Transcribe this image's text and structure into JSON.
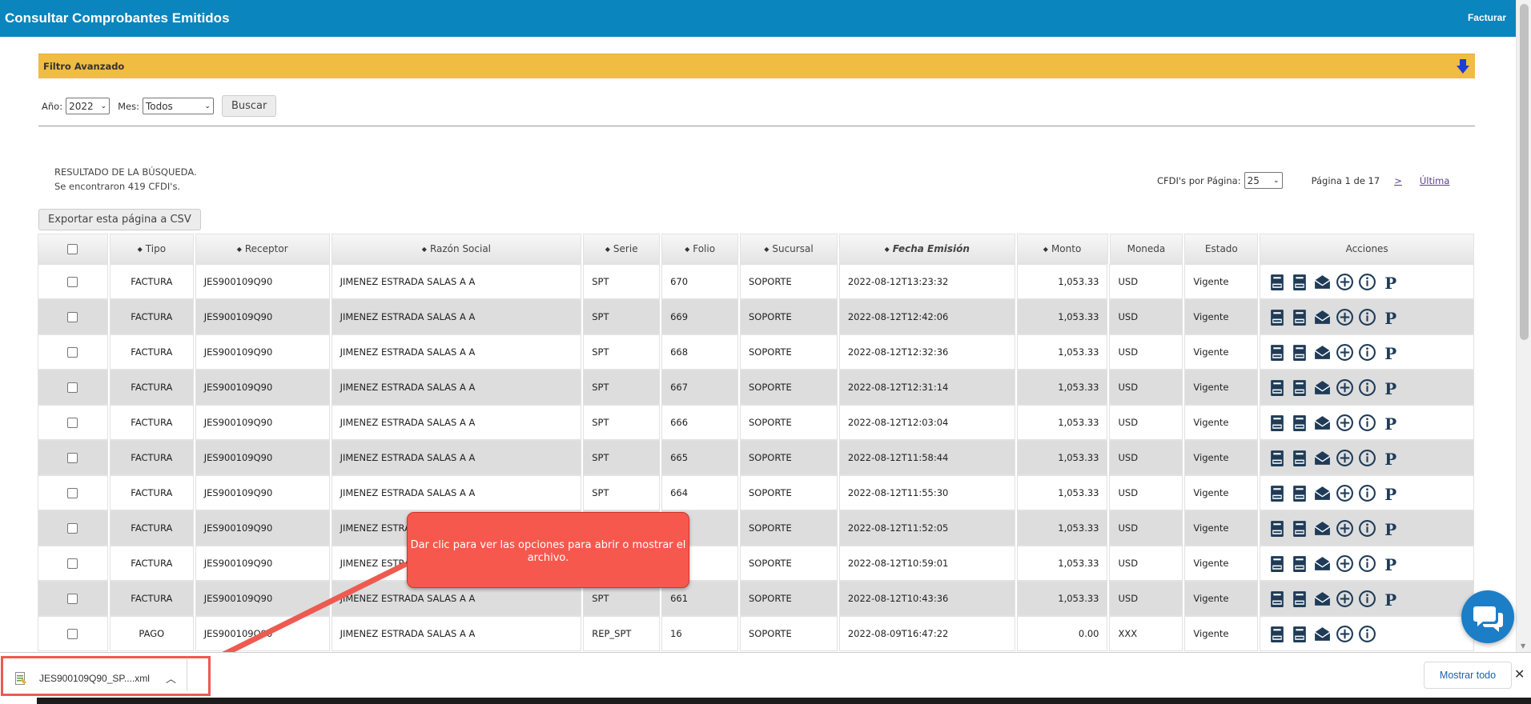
{
  "header": {
    "title": "Consultar Comprobantes Emitidos",
    "right_link": "Facturar"
  },
  "filter": {
    "title": "Filtro Avanzado",
    "year_label": "Año:",
    "year_value": "2022",
    "month_label": "Mes:",
    "month_value": "Todos",
    "search_button": "Buscar"
  },
  "result": {
    "line1": "RESULTADO DE LA BÚSQUEDA.",
    "line2": "Se encontraron 419 CFDI's."
  },
  "paging": {
    "per_page_label": "CFDI's por Página:",
    "per_page_value": "25",
    "page_info": "Página 1 de 17",
    "next": ">",
    "last": "Última"
  },
  "export_button": "Exportar esta página a CSV",
  "table": {
    "headers": [
      "Tipo",
      "Receptor",
      "Razón Social",
      "Serie",
      "Folio",
      "Sucursal",
      "Fecha Emisión",
      "Monto",
      "Moneda",
      "Estado",
      "Acciones"
    ],
    "rows": [
      {
        "tipo": "FACTURA",
        "receptor": "JES900109Q90",
        "razon": "JIMENEZ ESTRADA SALAS A A",
        "serie": "SPT",
        "folio": "670",
        "sucursal": "SOPORTE",
        "fecha": "2022-08-12T13:23:32",
        "monto": "1,053.33",
        "moneda": "USD",
        "estado": "Vigente"
      },
      {
        "tipo": "FACTURA",
        "receptor": "JES900109Q90",
        "razon": "JIMENEZ ESTRADA SALAS A A",
        "serie": "SPT",
        "folio": "669",
        "sucursal": "SOPORTE",
        "fecha": "2022-08-12T12:42:06",
        "monto": "1,053.33",
        "moneda": "USD",
        "estado": "Vigente"
      },
      {
        "tipo": "FACTURA",
        "receptor": "JES900109Q90",
        "razon": "JIMENEZ ESTRADA SALAS A A",
        "serie": "SPT",
        "folio": "668",
        "sucursal": "SOPORTE",
        "fecha": "2022-08-12T12:32:36",
        "monto": "1,053.33",
        "moneda": "USD",
        "estado": "Vigente"
      },
      {
        "tipo": "FACTURA",
        "receptor": "JES900109Q90",
        "razon": "JIMENEZ ESTRADA SALAS A A",
        "serie": "SPT",
        "folio": "667",
        "sucursal": "SOPORTE",
        "fecha": "2022-08-12T12:31:14",
        "monto": "1,053.33",
        "moneda": "USD",
        "estado": "Vigente"
      },
      {
        "tipo": "FACTURA",
        "receptor": "JES900109Q90",
        "razon": "JIMENEZ ESTRADA SALAS A A",
        "serie": "SPT",
        "folio": "666",
        "sucursal": "SOPORTE",
        "fecha": "2022-08-12T12:03:04",
        "monto": "1,053.33",
        "moneda": "USD",
        "estado": "Vigente"
      },
      {
        "tipo": "FACTURA",
        "receptor": "JES900109Q90",
        "razon": "JIMENEZ ESTRADA SALAS A A",
        "serie": "SPT",
        "folio": "665",
        "sucursal": "SOPORTE",
        "fecha": "2022-08-12T11:58:44",
        "monto": "1,053.33",
        "moneda": "USD",
        "estado": "Vigente"
      },
      {
        "tipo": "FACTURA",
        "receptor": "JES900109Q90",
        "razon": "JIMENEZ ESTRADA SALAS A A",
        "serie": "SPT",
        "folio": "664",
        "sucursal": "SOPORTE",
        "fecha": "2022-08-12T11:55:30",
        "monto": "1,053.33",
        "moneda": "USD",
        "estado": "Vigente"
      },
      {
        "tipo": "FACTURA",
        "receptor": "JES900109Q90",
        "razon": "JIMENEZ ESTRADA SALAS A A",
        "serie": "",
        "folio": "",
        "sucursal": "SOPORTE",
        "fecha": "2022-08-12T11:52:05",
        "monto": "1,053.33",
        "moneda": "USD",
        "estado": "Vigente"
      },
      {
        "tipo": "FACTURA",
        "receptor": "JES900109Q90",
        "razon": "JIMENEZ ESTRADA SALAS A A",
        "serie": "",
        "folio": "",
        "sucursal": "SOPORTE",
        "fecha": "2022-08-12T10:59:01",
        "monto": "1,053.33",
        "moneda": "USD",
        "estado": "Vigente"
      },
      {
        "tipo": "FACTURA",
        "receptor": "JES900109Q90",
        "razon": "JIMENEZ ESTRADA SALAS A A",
        "serie": "SPT",
        "folio": "661",
        "sucursal": "SOPORTE",
        "fecha": "2022-08-12T10:43:36",
        "monto": "1,053.33",
        "moneda": "USD",
        "estado": "Vigente"
      },
      {
        "tipo": "PAGO",
        "receptor": "JES900109Q90",
        "razon": "JIMENEZ ESTRADA SALAS A A",
        "serie": "REP_SPT",
        "folio": "16",
        "sucursal": "SOPORTE",
        "fecha": "2022-08-09T16:47:22",
        "monto": "0.00",
        "moneda": "XXX",
        "estado": "Vigente"
      }
    ]
  },
  "tooltip": {
    "text": "Dar clic para ver las opciones para abrir o mostrar el archivo."
  },
  "download_bar": {
    "file_name": "JES900109Q90_SP....xml",
    "show_all": "Mostrar todo"
  },
  "colors": {
    "header": "#0a85be",
    "filter": "#f1bc42",
    "callout": "#f7584e",
    "chat": "#1c7ec6"
  }
}
